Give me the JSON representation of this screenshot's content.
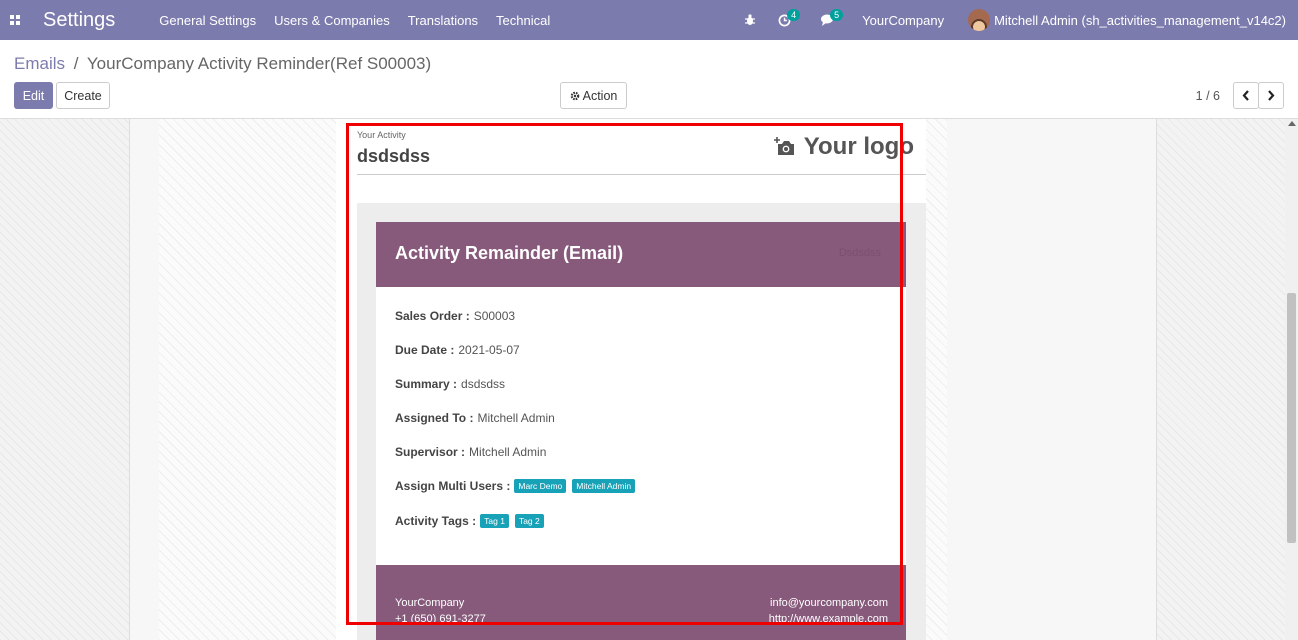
{
  "navbar": {
    "brand": "Settings",
    "menu": [
      "General Settings",
      "Users & Companies",
      "Translations",
      "Technical"
    ],
    "activity_count": "4",
    "message_count": "5",
    "company": "YourCompany",
    "user": "Mitchell Admin (sh_activities_management_v14c2)"
  },
  "breadcrumb": {
    "parent": "Emails",
    "separator": "/",
    "current": "YourCompany Activity Reminder(Ref S00003)"
  },
  "toolbar": {
    "edit_label": "Edit",
    "create_label": "Create",
    "action_label": "Action",
    "pager": "1 / 6"
  },
  "doc": {
    "label": "Your Activity",
    "title": "dsdsdss",
    "logo": "Your logo"
  },
  "email": {
    "header_title": "Activity Remainder (Email)",
    "header_faint": "Dsdsdss",
    "sales_order_label": "Sales Order :",
    "sales_order_value": "S00003",
    "due_date_label": "Due Date :",
    "due_date_value": "2021-05-07",
    "summary_label": "Summary :",
    "summary_value": "dsdsdss",
    "assigned_label": "Assigned To :",
    "assigned_value": "Mitchell Admin",
    "supervisor_label": "Supervisor :",
    "supervisor_value": "Mitchell Admin",
    "multi_users_label": "Assign Multi Users :",
    "multi_users": [
      "Marc Demo",
      "Mitchell Admin"
    ],
    "tags_label": "Activity Tags :",
    "tags": [
      "Tag 1",
      "Tag 2"
    ],
    "footer_company": "YourCompany",
    "footer_phone": "+1 (650) 691-3277",
    "footer_email": "info@yourcompany.com",
    "footer_web": "http://www.example.com"
  },
  "colors": {
    "navbar": "#7c7bad",
    "email_primary": "#875a7b",
    "tag": "#17a2b8",
    "highlight": "#e00000"
  }
}
